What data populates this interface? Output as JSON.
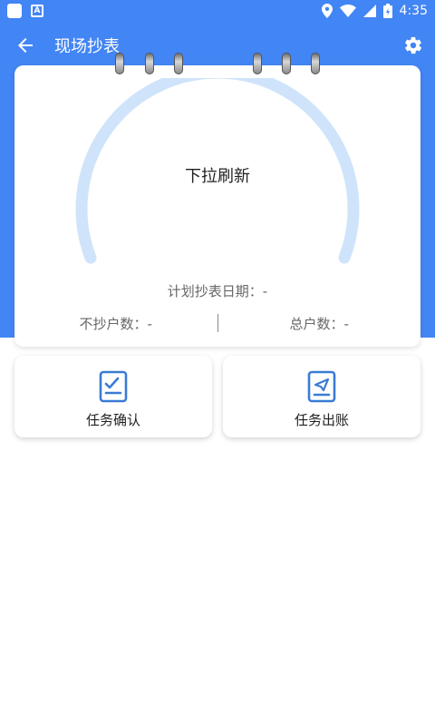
{
  "status_bar": {
    "time": "4:35",
    "icons": [
      "square-icon",
      "a-icon",
      "location-icon",
      "wifi-icon",
      "signal-icon",
      "battery-icon"
    ]
  },
  "app_bar": {
    "title": "现场抄表",
    "back_icon": "arrow-left-icon",
    "settings_icon": "gear-icon"
  },
  "card": {
    "refresh_hint": "下拉刷新",
    "plan_date_label": "计划抄表日期：-",
    "not_read_label": "不抄户数：-",
    "total_label": "总户数：-"
  },
  "actions": [
    {
      "label": "任务确认",
      "icon": "task-confirm-icon"
    },
    {
      "label": "任务出账",
      "icon": "task-bill-icon"
    }
  ],
  "colors": {
    "primary": "#4285f4",
    "gauge_track": "#cfe4fb",
    "icon_blue": "#3a7bd5"
  }
}
